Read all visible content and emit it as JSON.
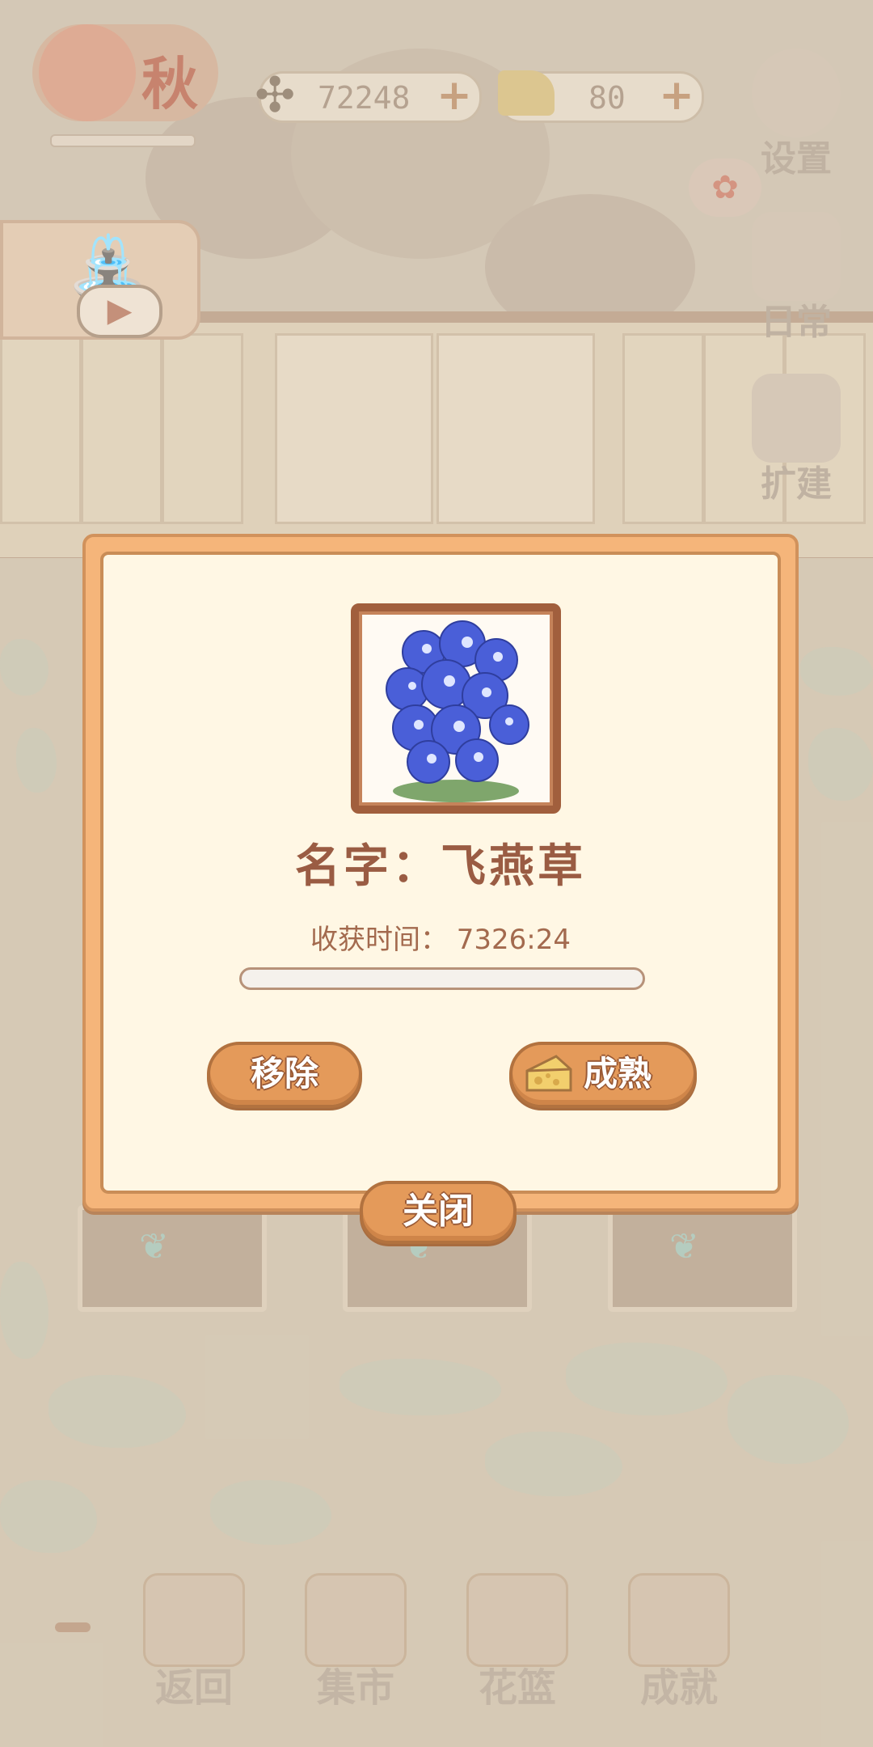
{
  "hud": {
    "season_label": "秋",
    "fish_count": "72248",
    "cheese_count": "80",
    "settings_label": "设置",
    "daily_label": "日常",
    "expand_label": "扩建"
  },
  "dialog": {
    "flower_image": "delphinium-flower",
    "name_text": "名字：飞燕草",
    "harvest_text": "收获时间：  7326:24",
    "progress": 0.0,
    "remove_label": "移除",
    "ripen_label": "成熟",
    "close_label": "关闭"
  },
  "bottom_nav": {
    "items": [
      {
        "label": "返回",
        "icon": "window-icon"
      },
      {
        "label": "集市",
        "icon": "market-stall-icon"
      },
      {
        "label": "花篮",
        "icon": "flower-basket-icon"
      },
      {
        "label": "成就",
        "icon": "trophy-icon"
      }
    ]
  },
  "colors": {
    "dialog_border": "#f5b57a",
    "dialog_bg": "#fff7e4",
    "button": "#e49a5a",
    "title_text": "#9a5c43"
  }
}
